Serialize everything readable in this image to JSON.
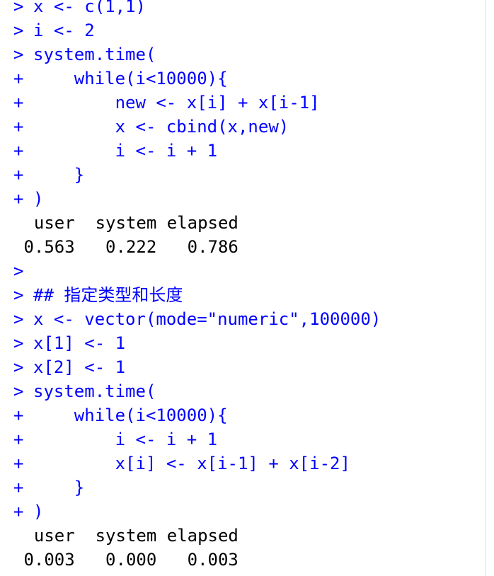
{
  "console": {
    "lines": [
      {
        "prompt": ">",
        "text": "x <- c(1,1)",
        "kind": "code"
      },
      {
        "prompt": ">",
        "text": "i <- 2",
        "kind": "code"
      },
      {
        "prompt": ">",
        "text": "system.time(",
        "kind": "code"
      },
      {
        "prompt": "+",
        "text": "    while(i<10000){",
        "kind": "code"
      },
      {
        "prompt": "+",
        "text": "        new <- x[i] + x[i-1]",
        "kind": "code"
      },
      {
        "prompt": "+",
        "text": "        x <- cbind(x,new)",
        "kind": "code"
      },
      {
        "prompt": "+",
        "text": "        i <- i + 1",
        "kind": "code"
      },
      {
        "prompt": "+",
        "text": "    }",
        "kind": "code"
      },
      {
        "prompt": "+",
        "text": ")",
        "kind": "code"
      },
      {
        "prompt": "",
        "text": "  user  system elapsed",
        "kind": "output"
      },
      {
        "prompt": "",
        "text": " 0.563   0.222   0.786",
        "kind": "output"
      },
      {
        "prompt": ">",
        "text": "",
        "kind": "code"
      },
      {
        "prompt": ">",
        "text": "## 指定类型和长度",
        "kind": "code"
      },
      {
        "prompt": ">",
        "text": "x <- vector(mode=\"numeric\",100000)",
        "kind": "code"
      },
      {
        "prompt": ">",
        "text": "x[1] <- 1",
        "kind": "code"
      },
      {
        "prompt": ">",
        "text": "x[2] <- 1",
        "kind": "code"
      },
      {
        "prompt": ">",
        "text": "system.time(",
        "kind": "code"
      },
      {
        "prompt": "+",
        "text": "    while(i<10000){",
        "kind": "code"
      },
      {
        "prompt": "+",
        "text": "        i <- i + 1",
        "kind": "code"
      },
      {
        "prompt": "+",
        "text": "        x[i] <- x[i-1] + x[i-2]",
        "kind": "code"
      },
      {
        "prompt": "+",
        "text": "    }",
        "kind": "code"
      },
      {
        "prompt": "+",
        "text": ")",
        "kind": "code"
      },
      {
        "prompt": "",
        "text": "  user  system elapsed",
        "kind": "output"
      },
      {
        "prompt": "",
        "text": " 0.003   0.000   0.003",
        "kind": "output"
      }
    ]
  }
}
